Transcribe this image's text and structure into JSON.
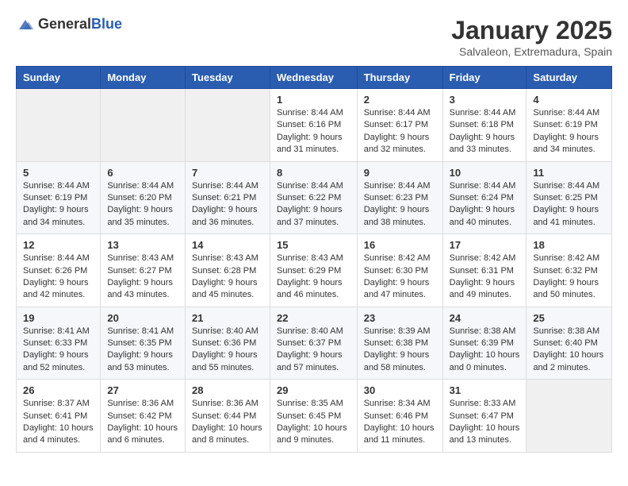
{
  "logo": {
    "general": "General",
    "blue": "Blue"
  },
  "title": "January 2025",
  "location": "Salvaleon, Extremadura, Spain",
  "weekdays": [
    "Sunday",
    "Monday",
    "Tuesday",
    "Wednesday",
    "Thursday",
    "Friday",
    "Saturday"
  ],
  "weeks": [
    [
      {
        "day": "",
        "sunrise": "",
        "sunset": "",
        "daylight": ""
      },
      {
        "day": "",
        "sunrise": "",
        "sunset": "",
        "daylight": ""
      },
      {
        "day": "",
        "sunrise": "",
        "sunset": "",
        "daylight": ""
      },
      {
        "day": "1",
        "sunrise": "Sunrise: 8:44 AM",
        "sunset": "Sunset: 6:16 PM",
        "daylight": "Daylight: 9 hours and 31 minutes."
      },
      {
        "day": "2",
        "sunrise": "Sunrise: 8:44 AM",
        "sunset": "Sunset: 6:17 PM",
        "daylight": "Daylight: 9 hours and 32 minutes."
      },
      {
        "day": "3",
        "sunrise": "Sunrise: 8:44 AM",
        "sunset": "Sunset: 6:18 PM",
        "daylight": "Daylight: 9 hours and 33 minutes."
      },
      {
        "day": "4",
        "sunrise": "Sunrise: 8:44 AM",
        "sunset": "Sunset: 6:19 PM",
        "daylight": "Daylight: 9 hours and 34 minutes."
      }
    ],
    [
      {
        "day": "5",
        "sunrise": "Sunrise: 8:44 AM",
        "sunset": "Sunset: 6:19 PM",
        "daylight": "Daylight: 9 hours and 34 minutes."
      },
      {
        "day": "6",
        "sunrise": "Sunrise: 8:44 AM",
        "sunset": "Sunset: 6:20 PM",
        "daylight": "Daylight: 9 hours and 35 minutes."
      },
      {
        "day": "7",
        "sunrise": "Sunrise: 8:44 AM",
        "sunset": "Sunset: 6:21 PM",
        "daylight": "Daylight: 9 hours and 36 minutes."
      },
      {
        "day": "8",
        "sunrise": "Sunrise: 8:44 AM",
        "sunset": "Sunset: 6:22 PM",
        "daylight": "Daylight: 9 hours and 37 minutes."
      },
      {
        "day": "9",
        "sunrise": "Sunrise: 8:44 AM",
        "sunset": "Sunset: 6:23 PM",
        "daylight": "Daylight: 9 hours and 38 minutes."
      },
      {
        "day": "10",
        "sunrise": "Sunrise: 8:44 AM",
        "sunset": "Sunset: 6:24 PM",
        "daylight": "Daylight: 9 hours and 40 minutes."
      },
      {
        "day": "11",
        "sunrise": "Sunrise: 8:44 AM",
        "sunset": "Sunset: 6:25 PM",
        "daylight": "Daylight: 9 hours and 41 minutes."
      }
    ],
    [
      {
        "day": "12",
        "sunrise": "Sunrise: 8:44 AM",
        "sunset": "Sunset: 6:26 PM",
        "daylight": "Daylight: 9 hours and 42 minutes."
      },
      {
        "day": "13",
        "sunrise": "Sunrise: 8:43 AM",
        "sunset": "Sunset: 6:27 PM",
        "daylight": "Daylight: 9 hours and 43 minutes."
      },
      {
        "day": "14",
        "sunrise": "Sunrise: 8:43 AM",
        "sunset": "Sunset: 6:28 PM",
        "daylight": "Daylight: 9 hours and 45 minutes."
      },
      {
        "day": "15",
        "sunrise": "Sunrise: 8:43 AM",
        "sunset": "Sunset: 6:29 PM",
        "daylight": "Daylight: 9 hours and 46 minutes."
      },
      {
        "day": "16",
        "sunrise": "Sunrise: 8:42 AM",
        "sunset": "Sunset: 6:30 PM",
        "daylight": "Daylight: 9 hours and 47 minutes."
      },
      {
        "day": "17",
        "sunrise": "Sunrise: 8:42 AM",
        "sunset": "Sunset: 6:31 PM",
        "daylight": "Daylight: 9 hours and 49 minutes."
      },
      {
        "day": "18",
        "sunrise": "Sunrise: 8:42 AM",
        "sunset": "Sunset: 6:32 PM",
        "daylight": "Daylight: 9 hours and 50 minutes."
      }
    ],
    [
      {
        "day": "19",
        "sunrise": "Sunrise: 8:41 AM",
        "sunset": "Sunset: 6:33 PM",
        "daylight": "Daylight: 9 hours and 52 minutes."
      },
      {
        "day": "20",
        "sunrise": "Sunrise: 8:41 AM",
        "sunset": "Sunset: 6:35 PM",
        "daylight": "Daylight: 9 hours and 53 minutes."
      },
      {
        "day": "21",
        "sunrise": "Sunrise: 8:40 AM",
        "sunset": "Sunset: 6:36 PM",
        "daylight": "Daylight: 9 hours and 55 minutes."
      },
      {
        "day": "22",
        "sunrise": "Sunrise: 8:40 AM",
        "sunset": "Sunset: 6:37 PM",
        "daylight": "Daylight: 9 hours and 57 minutes."
      },
      {
        "day": "23",
        "sunrise": "Sunrise: 8:39 AM",
        "sunset": "Sunset: 6:38 PM",
        "daylight": "Daylight: 9 hours and 58 minutes."
      },
      {
        "day": "24",
        "sunrise": "Sunrise: 8:38 AM",
        "sunset": "Sunset: 6:39 PM",
        "daylight": "Daylight: 10 hours and 0 minutes."
      },
      {
        "day": "25",
        "sunrise": "Sunrise: 8:38 AM",
        "sunset": "Sunset: 6:40 PM",
        "daylight": "Daylight: 10 hours and 2 minutes."
      }
    ],
    [
      {
        "day": "26",
        "sunrise": "Sunrise: 8:37 AM",
        "sunset": "Sunset: 6:41 PM",
        "daylight": "Daylight: 10 hours and 4 minutes."
      },
      {
        "day": "27",
        "sunrise": "Sunrise: 8:36 AM",
        "sunset": "Sunset: 6:42 PM",
        "daylight": "Daylight: 10 hours and 6 minutes."
      },
      {
        "day": "28",
        "sunrise": "Sunrise: 8:36 AM",
        "sunset": "Sunset: 6:44 PM",
        "daylight": "Daylight: 10 hours and 8 minutes."
      },
      {
        "day": "29",
        "sunrise": "Sunrise: 8:35 AM",
        "sunset": "Sunset: 6:45 PM",
        "daylight": "Daylight: 10 hours and 9 minutes."
      },
      {
        "day": "30",
        "sunrise": "Sunrise: 8:34 AM",
        "sunset": "Sunset: 6:46 PM",
        "daylight": "Daylight: 10 hours and 11 minutes."
      },
      {
        "day": "31",
        "sunrise": "Sunrise: 8:33 AM",
        "sunset": "Sunset: 6:47 PM",
        "daylight": "Daylight: 10 hours and 13 minutes."
      },
      {
        "day": "",
        "sunrise": "",
        "sunset": "",
        "daylight": ""
      }
    ]
  ]
}
